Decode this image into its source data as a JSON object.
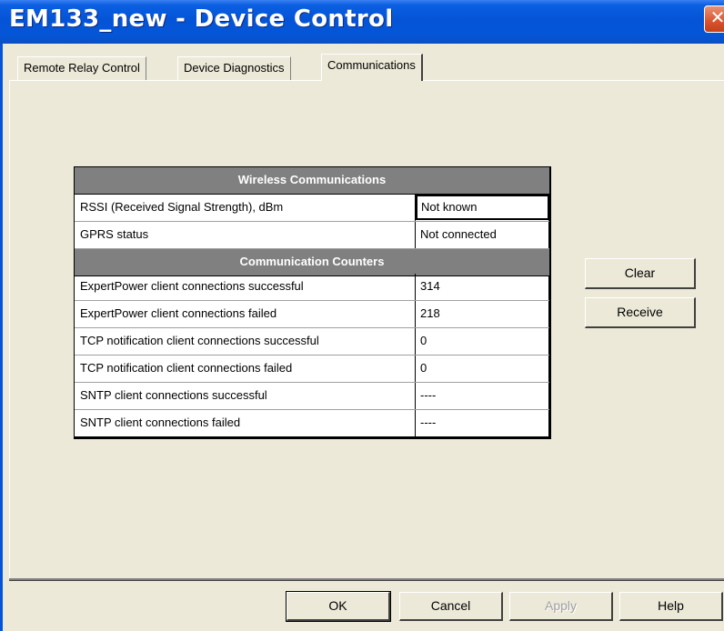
{
  "window": {
    "title": "EM133_new - Device Control",
    "close_glyph": "✕"
  },
  "tabs": [
    {
      "label": "Remote Relay Control",
      "active": false
    },
    {
      "label": "Device Diagnostics",
      "active": false
    },
    {
      "label": "Communications",
      "active": true
    }
  ],
  "grid": {
    "wireless_header": "Wireless Communications",
    "wireless_rows": [
      {
        "label": "RSSI (Received Signal Strength), dBm",
        "value": "Not known"
      },
      {
        "label": "GPRS status",
        "value": "Not connected"
      }
    ],
    "counters_header": "Communication Counters",
    "counter_rows": [
      {
        "label": "ExpertPower client connections successful",
        "value": "314"
      },
      {
        "label": "ExpertPower client connections failed",
        "value": "218"
      },
      {
        "label": "TCP notification client connections successful",
        "value": "0"
      },
      {
        "label": "TCP notification client connections failed",
        "value": "0"
      },
      {
        "label": "SNTP client connections successful",
        "value": "----"
      },
      {
        "label": "SNTP client connections failed",
        "value": "----"
      }
    ]
  },
  "side_buttons": {
    "clear": "Clear",
    "receive": "Receive"
  },
  "footer_buttons": {
    "ok": "OK",
    "cancel": "Cancel",
    "apply": "Apply",
    "help": "Help"
  },
  "colors": {
    "titlebar": "#0554d8",
    "face": "#ECE9D8",
    "grid_header": "#808080",
    "close": "#d9532c"
  }
}
